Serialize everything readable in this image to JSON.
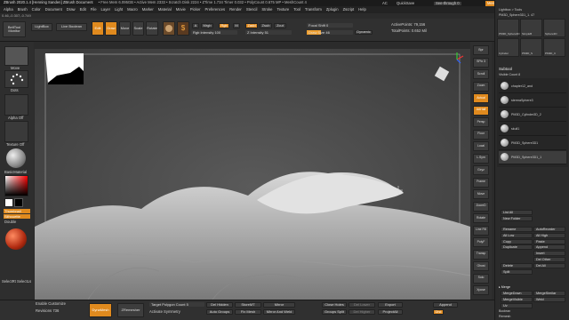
{
  "titlebar": {
    "title": "ZBrush 2020.1.4 [Henning Sanden]  ZBrush Document",
    "stats": "• Free Mem 6.095GB • Active Mem 2333 • Scratch Disk 2224 • ZTime 1.734 Timer 0.032 • PolyCount 0.675 MP • MeshCount 4",
    "right": [
      "AC",
      "QuickSave",
      "See-through 0",
      "Menus",
      "DefaultZScript"
    ]
  },
  "menu": [
    "Alpha",
    "Brush",
    "Color",
    "Document",
    "Draw",
    "Edit",
    "File",
    "Layer",
    "Light",
    "Macro",
    "Marker",
    "Material",
    "Movie",
    "Picker",
    "Preferences",
    "Render",
    "Stencil",
    "Stroke",
    "Texture",
    "Tool",
    "Transform",
    "Zplugin",
    "Zscript",
    "Help"
  ],
  "coords": "0.46,-0.307,-0.749",
  "toolbar": {
    "home": "BeltTool Monitor",
    "lightbox": "LightBox",
    "live_boolean": "Live Boolean",
    "edit": "Edit",
    "draw": "Draw",
    "move": "Move",
    "scale": "Scale",
    "rotate": "Rotate",
    "a": "A",
    "mrgb": "Mrgb",
    "rgb": "Rgb",
    "m": "M",
    "zadd": "Zadd",
    "zsub": "Zsub",
    "zcut": "Zcut",
    "rgb_intensity": "Rgb Intensity 100",
    "z_intensity": "Z Intensity 51",
    "focal_shift": "Focal Shift 0",
    "draw_size": "Draw Size 46",
    "dynamic": "Dynamic",
    "active_points": "ActivePoints: 79,156",
    "total_points": "TotalPoints: 0.652 Mil"
  },
  "left": {
    "brush": "Move",
    "stroke": "Dots",
    "alpha": "Alpha Off",
    "texture": "Texture Off",
    "material": "BasicMaterial",
    "gradient": "Gradient",
    "switch": "SwitchColor",
    "alternate": "Alternate",
    "thumb1": "Thumbnail",
    "thumb2": "Silhouette",
    "double": "Double",
    "seldots": "SelectRt SelectLs"
  },
  "right_tray": [
    "Bpr",
    "SPix 3",
    "Scroll",
    "Zoom",
    "Actual",
    "AAHalf",
    "Persp",
    "Floor",
    "Local",
    "L.Sym",
    "Gxyz",
    "Frame",
    "Move",
    "ZoomD",
    "Rotate",
    "Line Fill",
    "PolyF",
    "Transp",
    "Ghost",
    "Solo",
    "Xpose"
  ],
  "panel": {
    "lightbox_tools": "Lightbox > Tools",
    "tool_name": "PM3D_Sphere3D1_1. 47",
    "thumbs": [
      "PM3D_Sphere3D",
      "SimpleB",
      "Sphere3D",
      "Cylinder",
      "PM3D_S",
      "PM3D_C"
    ],
    "subtool": "Subtool",
    "visible": "Visible Count 8",
    "items": [
      "chapter12_and",
      "stermaSphere3",
      "PM3D_Cylinder3D_2",
      "skull1",
      "PM3D_Sphere3D1",
      "PM3D_Sphere3D1_1"
    ],
    "list_all": "List All",
    "new_folder": "New Folder",
    "ops": [
      [
        "Rename",
        "AutoReorder"
      ],
      [
        "All Low",
        "All High"
      ],
      [
        "Copy",
        "Paste"
      ],
      [
        "Duplicate",
        "Append"
      ],
      [
        "",
        "Insert"
      ],
      [
        "",
        "Del Other"
      ],
      [
        "Delete",
        "Del All"
      ],
      [
        "Split",
        ""
      ]
    ],
    "merge": "▸ Merge",
    "merge_ops": [
      [
        "MergeDown",
        "MergeSimilar"
      ],
      [
        "MergeVisible",
        "Weld"
      ],
      [
        "Uv",
        ""
      ]
    ],
    "boolean": "Boolean",
    "remesh": "Remesh"
  },
  "bottom": {
    "enable_customize": "Enable Customize",
    "revisions": "Revisions 736",
    "dynamesh": "DynaMesh",
    "zremesher": "ZRemesher",
    "target_poly": "Target Polygon Count 5",
    "activate_symmetry": "Activate Symmetry",
    "del_hidden": "Del Hidden",
    "auto_groups": "Auto Groups",
    "store_mt": "StoreMT",
    "fix_mesh": "Fix Mesh",
    "mirror": "Mirror",
    "mirror_weld": "Mirror And Weld",
    "close_holes": "Close Holes",
    "groups_split": "Groups Split",
    "del_lower": "Del Lower",
    "del_higher": "Del Higher",
    "export": "Export",
    "project_all": "ProjectAll",
    "append": "Append",
    "dist": "Dist"
  }
}
